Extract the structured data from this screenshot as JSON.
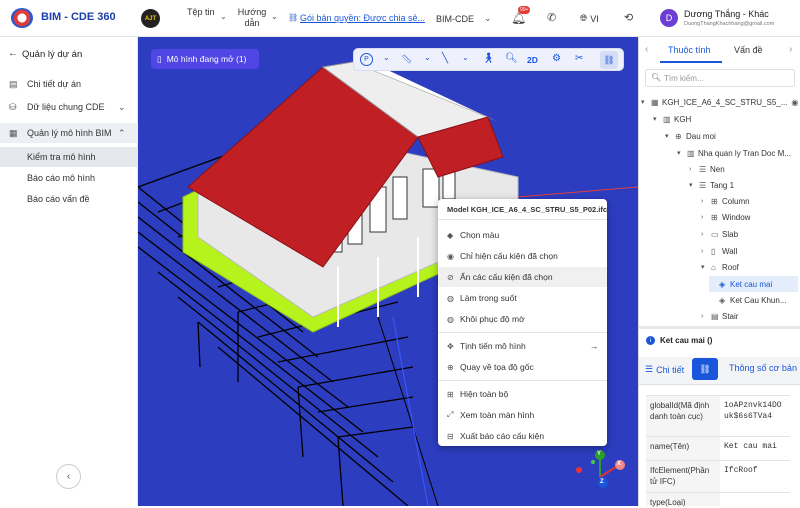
{
  "app": {
    "name": "BIM - CDE 360",
    "logo_text": "CDE"
  },
  "topbar": {
    "menu_file": "Tệp tin",
    "menu_guide": "Hướng dẫn",
    "license_link": "Gói bản quyền: Được chia sẻ...",
    "project_select": "BIM-CDE",
    "notification_count": "99+",
    "language": "VI",
    "user_initial": "D",
    "user_name": "Dương Thắng - Khác",
    "user_email": "DuongThangKhachhang@gmail.com"
  },
  "sidebar": {
    "title": "Quản lý dự án",
    "items": [
      {
        "label": "Chi tiết dự án"
      },
      {
        "label": "Dữ liệu chung CDE"
      },
      {
        "label": "Quản lý mô hình BIM"
      }
    ],
    "sub_items": [
      {
        "label": "Kiểm tra mô hình"
      },
      {
        "label": "Báo cáo mô hình"
      },
      {
        "label": "Báo cáo vấn đề"
      }
    ]
  },
  "viewer": {
    "open_models_button": "Mô hình đang mở (1)",
    "toolbar_2d": "2D",
    "colors": {
      "sky": "#2c3dc0",
      "roof": "#c01f24",
      "floor": "#b6f21c",
      "accent": "#1a56db"
    }
  },
  "context_menu": {
    "title": "Model KGH_ICE_A6_4_SC_STRU_S5_P02.ifc",
    "items": [
      {
        "label": "Chọn màu",
        "icon": "paint-icon"
      },
      {
        "label": "Chỉ hiện cấu kiện đã chọn",
        "icon": "eye-icon"
      },
      {
        "label": "Ẩn các cấu kiện đã chọn",
        "icon": "eye-off-icon"
      },
      {
        "label": "Làm trong suốt",
        "icon": "drop-icon"
      },
      {
        "label": "Khôi phục độ mờ",
        "icon": "drop-icon"
      },
      {
        "label": "Tịnh tiến mô hình",
        "icon": "move-icon"
      },
      {
        "label": "Quay về tọa độ gốc",
        "icon": "target-icon"
      },
      {
        "label": "Hiện toàn bộ",
        "icon": "grid-icon"
      },
      {
        "label": "Xem toàn màn hình",
        "icon": "fullscreen-icon"
      },
      {
        "label": "Xuất báo cáo cấu kiện",
        "icon": "export-icon"
      }
    ]
  },
  "right_panel": {
    "tab_properties": "Thuộc tính",
    "tab_issues": "Vấn đề",
    "search_placeholder": "Tìm kiếm...",
    "tree": [
      {
        "label": "KGH_ICE_A6_4_SC_STRU_S5_..."
      },
      {
        "label": "KGH"
      },
      {
        "label": "Dau moi"
      },
      {
        "label": "Nha quan ly Tran Doc M..."
      },
      {
        "label": "Nen"
      },
      {
        "label": "Tang 1"
      },
      {
        "label": "Column"
      },
      {
        "label": "Window"
      },
      {
        "label": "Slab"
      },
      {
        "label": "Wall"
      },
      {
        "label": "Roof"
      },
      {
        "label": "Ket cau mai"
      },
      {
        "label": "Ket Cau Khun..."
      },
      {
        "label": "Stair"
      }
    ],
    "selected_title": "Ket cau mai ()",
    "detail_tab": "Chi tiết",
    "basic_tab": "Thông số cơ bản",
    "props": [
      {
        "key": "globalId(Mã định danh toàn cục)",
        "value": "1oAPznvk14DOuk$6s6TVa4"
      },
      {
        "key": "name(Tên)",
        "value": "Ket cau mai"
      },
      {
        "key": "IfcElement(Phần tử IFC)",
        "value": "IfcRoof"
      },
      {
        "key": "type(Loại)",
        "value": ""
      }
    ]
  },
  "axes": {
    "x": "X",
    "y": "Y",
    "z": "Z"
  }
}
